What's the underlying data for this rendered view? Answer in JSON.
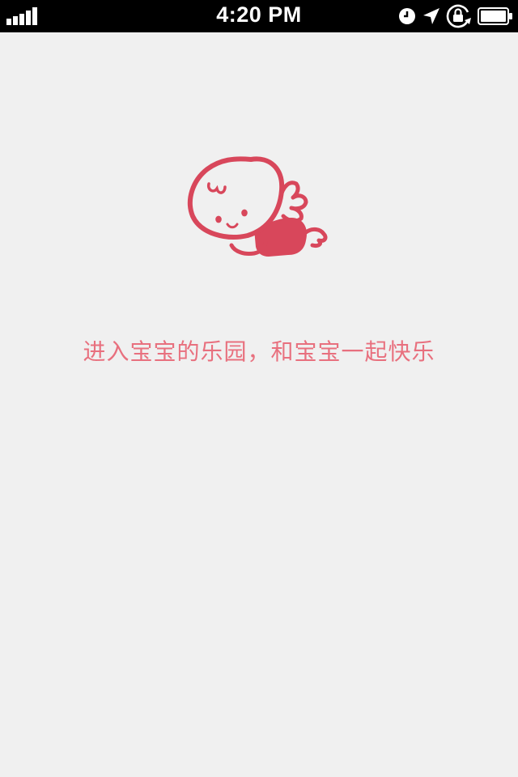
{
  "status_bar": {
    "time": "4:20 PM",
    "icons": [
      "signal-bars-icon",
      "alarm-clock-icon",
      "location-arrow-icon",
      "rotation-lock-icon",
      "battery-icon"
    ]
  },
  "main": {
    "mascot_icon": "crawling-baby-angel-icon",
    "tagline": "进入宝宝的乐园，和宝宝一起快乐"
  },
  "colors": {
    "accent": "#d8475b",
    "tagline": "#e8707e",
    "background": "#f0f0f0",
    "status_bar": "#000000"
  }
}
